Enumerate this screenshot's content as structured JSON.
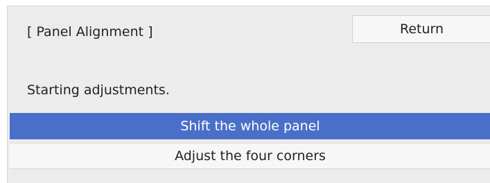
{
  "dialog": {
    "title": "[ Panel Alignment ]",
    "return_label": "Return",
    "message": "Starting adjustments.",
    "options": [
      {
        "label": "Shift the whole panel",
        "selected": true
      },
      {
        "label": "Adjust the four corners",
        "selected": false
      }
    ]
  },
  "colors": {
    "panel_background": "#ececec",
    "selected_background": "#4a6fc9",
    "selected_text": "#ffffff",
    "button_background": "#f7f7f7"
  }
}
